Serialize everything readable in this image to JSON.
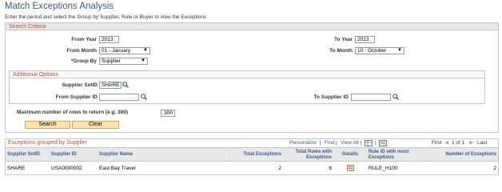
{
  "page": {
    "title": "Match Exceptions Analysis",
    "instructions": "Enter the period and select the Group by Supplier, Rule or Buyer to view the Exceptions"
  },
  "search_criteria": {
    "header": "Search Criteria",
    "from_year_label": "From Year",
    "from_year_value": "2013",
    "to_year_label": "To Year",
    "to_year_value": "2013",
    "from_month_label": "From Month",
    "from_month_value": "01 - January",
    "to_month_label": "To Month",
    "to_month_value": "10 - October",
    "group_by_label": "*Group By",
    "group_by_value": "Supplier",
    "additional_options": {
      "header": "Additional Options",
      "supplier_setid_label": "Supplier SetID",
      "supplier_setid_value": "SHARE",
      "from_supplier_label": "From Supplier ID",
      "from_supplier_value": "",
      "to_supplier_label": "To Supplier ID",
      "to_supplier_value": ""
    },
    "max_rows_label": "Maximum number of rows to return (e.g. 300)",
    "max_rows_value": "300",
    "search_button": "Search",
    "clear_button": "Clear"
  },
  "grid": {
    "title": "Exceptions grouped by Supplier",
    "personalize": "Personalize",
    "find": "Find",
    "view_all": "View All",
    "first": "First",
    "range": "1 of 1",
    "last": "Last",
    "columns": [
      "Supplier SetID",
      "Supplier ID",
      "Supplier Name",
      "Total Exceptions",
      "Total Rules with Exceptions",
      "Details",
      "Rule ID with most Exceptions",
      "Number of Exceptions"
    ],
    "rows": [
      {
        "setid": "SHARE",
        "supplier_id": "USA0000002",
        "supplier_name": "East Bay Travel",
        "total_exceptions": "2",
        "total_rules": "6",
        "rule_id": "RULE_H100",
        "num_exceptions": "2"
      }
    ]
  },
  "colors": {
    "title_blue": "#3c5b86",
    "section_header": "#b4503a",
    "button_fill": "#fbe3b0"
  }
}
